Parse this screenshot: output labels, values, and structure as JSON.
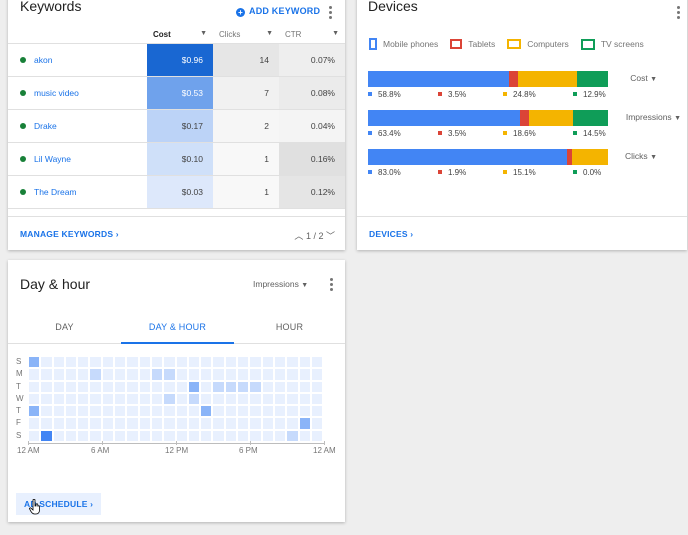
{
  "keywords": {
    "title": "Keywords",
    "add_label": "ADD KEYWORD",
    "columns": {
      "keyword": "",
      "cost": "Cost",
      "clicks": "Clicks",
      "ctr": "CTR"
    },
    "rows": [
      {
        "keyword": "akon",
        "cost": "$0.96",
        "clicks": "14",
        "ctr": "0.07%",
        "cost_color": "#1967d2",
        "clicks_color": "#e6e6e6",
        "ctr_color": "#eeeeee"
      },
      {
        "keyword": "music video",
        "cost": "$0.53",
        "clicks": "7",
        "ctr": "0.08%",
        "cost_color": "#6fa2ec",
        "clicks_color": "#f1f1f1",
        "ctr_color": "#ebebeb"
      },
      {
        "keyword": "Drake",
        "cost": "$0.17",
        "clicks": "2",
        "ctr": "0.04%",
        "cost_color": "#bcd3f7",
        "clicks_color": "#f6f6f6",
        "ctr_color": "#f4f4f4"
      },
      {
        "keyword": "Lil Wayne",
        "cost": "$0.10",
        "clicks": "1",
        "ctr": "0.16%",
        "cost_color": "#cfe0f9",
        "clicks_color": "#f8f8f8",
        "ctr_color": "#e0e0e0"
      },
      {
        "keyword": "The Dream",
        "cost": "$0.03",
        "clicks": "1",
        "ctr": "0.12%",
        "cost_color": "#dde8fb",
        "clicks_color": "#f8f8f8",
        "ctr_color": "#e5e5e5"
      }
    ],
    "footer_link": "MANAGE KEYWORDS",
    "pager": "1 / 2"
  },
  "devices": {
    "title": "Devices",
    "legend": [
      {
        "label": "Mobile phones",
        "color": "#4285f4",
        "icon": "phone-icon"
      },
      {
        "label": "Tablets",
        "color": "#db4437",
        "icon": "tablet-icon"
      },
      {
        "label": "Computers",
        "color": "#f4b400",
        "icon": "computer-icon"
      },
      {
        "label": "TV screens",
        "color": "#0f9d58",
        "icon": "tv-icon"
      }
    ],
    "rows": [
      {
        "metric": "Cost",
        "values": [
          "58.8%",
          "3.5%",
          "24.8%",
          "12.9%"
        ],
        "shares": [
          58.8,
          3.5,
          24.8,
          12.9
        ]
      },
      {
        "metric": "Impressions",
        "values": [
          "63.4%",
          "3.5%",
          "18.6%",
          "14.5%"
        ],
        "shares": [
          63.4,
          3.5,
          18.6,
          14.5
        ]
      },
      {
        "metric": "Clicks",
        "values": [
          "83.0%",
          "1.9%",
          "15.1%",
          "0.0%"
        ],
        "shares": [
          83.0,
          1.9,
          15.1,
          0.0
        ]
      }
    ],
    "footer_link": "DEVICES"
  },
  "day_hour": {
    "title": "Day & hour",
    "metric": "Impressions",
    "tabs": [
      "DAY",
      "DAY & HOUR",
      "HOUR"
    ],
    "active_tab": 1,
    "days": [
      "S",
      "M",
      "T",
      "W",
      "T",
      "F",
      "S"
    ],
    "hour_labels": [
      "12 AM",
      "6 AM",
      "12 PM",
      "6 PM",
      "12 AM"
    ],
    "heatmap": [
      [
        3,
        1,
        1,
        1,
        1,
        1,
        1,
        1,
        1,
        1,
        1,
        1,
        1,
        1,
        1,
        1,
        1,
        1,
        1,
        1,
        1,
        1,
        1,
        1
      ],
      [
        1,
        1,
        1,
        1,
        1,
        2,
        1,
        1,
        1,
        1,
        2,
        2,
        1,
        1,
        1,
        1,
        1,
        1,
        1,
        1,
        1,
        1,
        1,
        1
      ],
      [
        1,
        1,
        1,
        1,
        1,
        1,
        1,
        1,
        1,
        1,
        1,
        1,
        1,
        3,
        1,
        2,
        2,
        2,
        2,
        1,
        1,
        1,
        1,
        1
      ],
      [
        1,
        1,
        1,
        1,
        1,
        1,
        1,
        1,
        1,
        1,
        1,
        2,
        1,
        2,
        1,
        1,
        1,
        1,
        1,
        1,
        1,
        1,
        1,
        1
      ],
      [
        3,
        1,
        1,
        1,
        1,
        1,
        1,
        1,
        1,
        1,
        1,
        1,
        1,
        1,
        3,
        1,
        1,
        1,
        1,
        1,
        1,
        1,
        1,
        1
      ],
      [
        1,
        1,
        1,
        1,
        1,
        1,
        1,
        1,
        1,
        1,
        1,
        1,
        1,
        1,
        1,
        1,
        1,
        1,
        1,
        1,
        1,
        1,
        3,
        1
      ],
      [
        1,
        4,
        1,
        1,
        1,
        1,
        1,
        1,
        1,
        1,
        1,
        1,
        1,
        1,
        1,
        1,
        1,
        1,
        1,
        1,
        1,
        2,
        1,
        1
      ]
    ],
    "schedule_button": "AD SCHEDULE"
  }
}
